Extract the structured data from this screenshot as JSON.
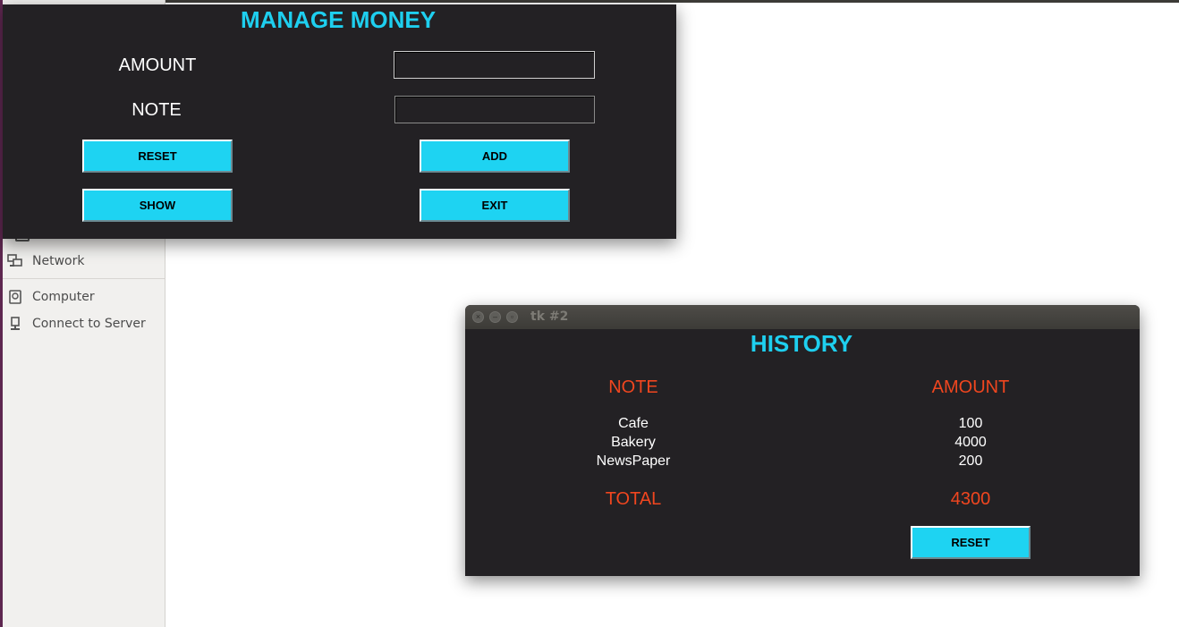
{
  "file_manager": {
    "sidebar": {
      "items": [
        {
          "label": "Network",
          "icon": "network-icon"
        },
        {
          "label": "Computer",
          "icon": "computer-icon"
        },
        {
          "label": "Connect to Server",
          "icon": "server-icon"
        }
      ]
    }
  },
  "manage_window": {
    "title": "MANAGE MONEY",
    "fields": {
      "amount_label": "AMOUNT",
      "amount_value": "",
      "note_label": "NOTE",
      "note_value": ""
    },
    "buttons": {
      "reset": "RESET",
      "add": "ADD",
      "show": "SHOW",
      "exit": "EXIT"
    }
  },
  "history_window": {
    "window_title": "tk #2",
    "title": "HISTORY",
    "columns": {
      "note": "NOTE",
      "amount": "AMOUNT"
    },
    "rows": [
      {
        "note": "Cafe",
        "amount": "100"
      },
      {
        "note": "Bakery",
        "amount": "4000"
      },
      {
        "note": "NewsPaper",
        "amount": "200"
      }
    ],
    "total_label": "TOTAL",
    "total_value": "4300",
    "reset_button": "RESET"
  },
  "colors": {
    "accent_cyan": "#1ed3f2",
    "heading_orange": "#f0461f",
    "window_bg": "#232124"
  }
}
